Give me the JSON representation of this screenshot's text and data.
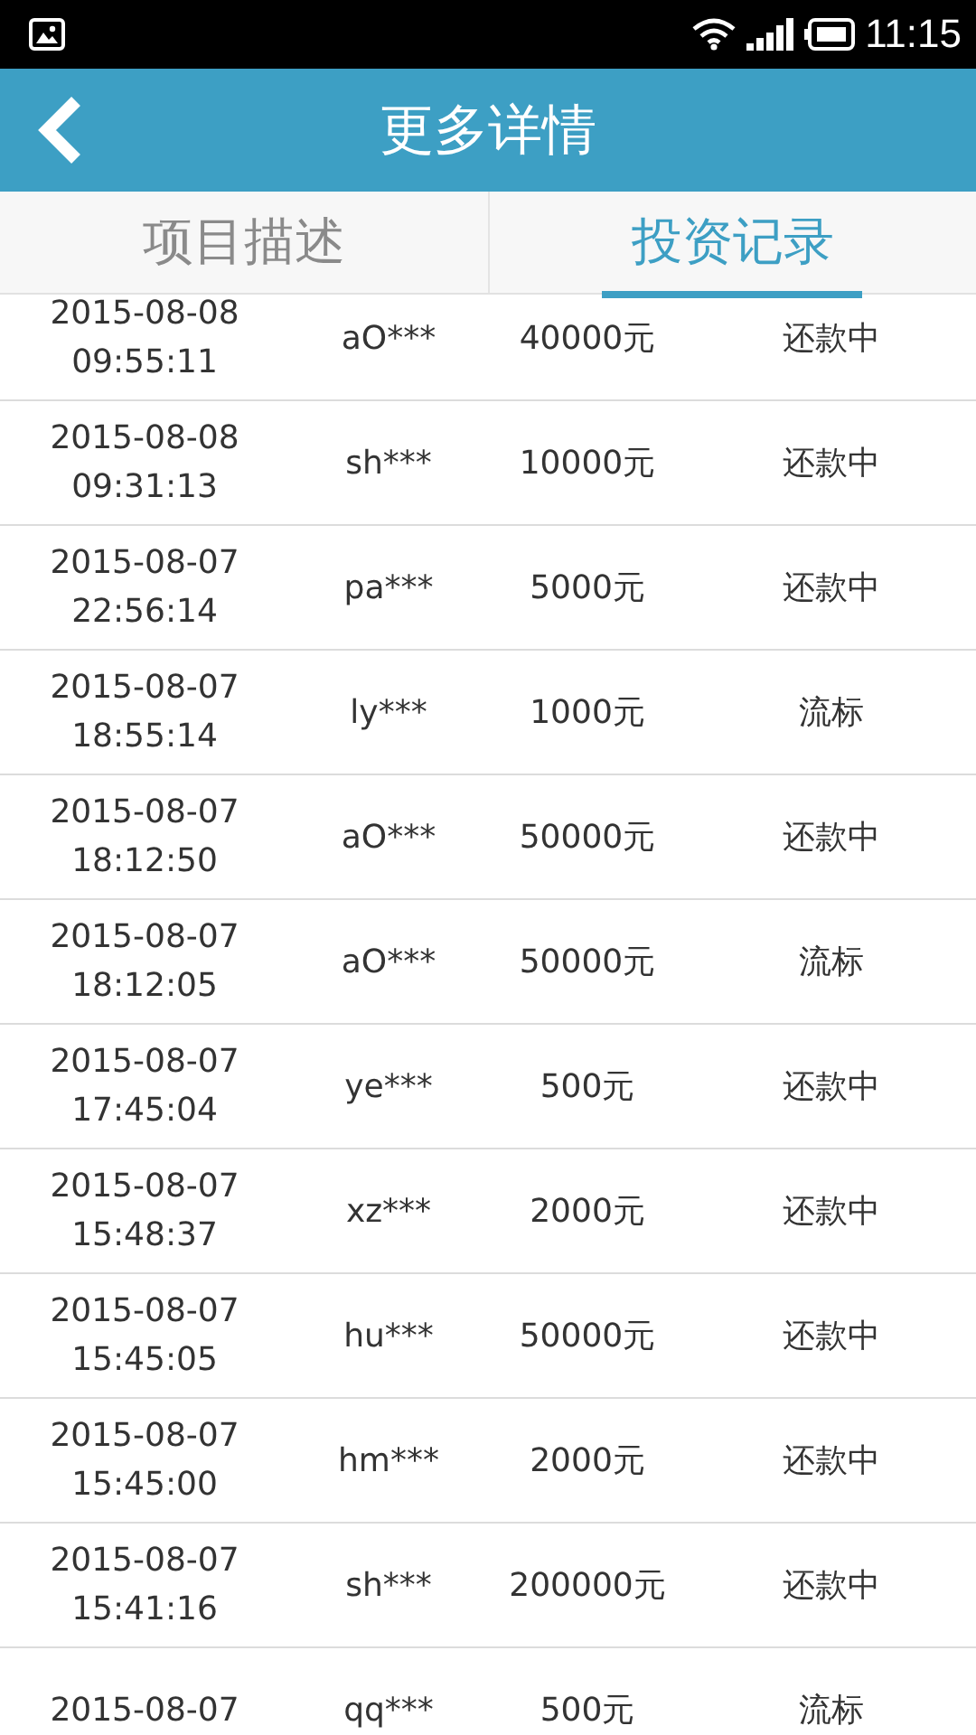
{
  "status_bar": {
    "time": "11:15"
  },
  "header": {
    "title": "更多详情"
  },
  "tabs": [
    {
      "label": "项目描述",
      "selected": false
    },
    {
      "label": "投资记录",
      "selected": true
    }
  ],
  "records": [
    {
      "date": "2015-08-08",
      "time": "09:55:11",
      "user": "aO***",
      "amount": "40000元",
      "status": "还款中"
    },
    {
      "date": "2015-08-08",
      "time": "09:31:13",
      "user": "sh***",
      "amount": "10000元",
      "status": "还款中"
    },
    {
      "date": "2015-08-07",
      "time": "22:56:14",
      "user": "pa***",
      "amount": "5000元",
      "status": "还款中"
    },
    {
      "date": "2015-08-07",
      "time": "18:55:14",
      "user": "ly***",
      "amount": "1000元",
      "status": "流标"
    },
    {
      "date": "2015-08-07",
      "time": "18:12:50",
      "user": "aO***",
      "amount": "50000元",
      "status": "还款中"
    },
    {
      "date": "2015-08-07",
      "time": "18:12:05",
      "user": "aO***",
      "amount": "50000元",
      "status": "流标"
    },
    {
      "date": "2015-08-07",
      "time": "17:45:04",
      "user": "ye***",
      "amount": "500元",
      "status": "还款中"
    },
    {
      "date": "2015-08-07",
      "time": "15:48:37",
      "user": "xz***",
      "amount": "2000元",
      "status": "还款中"
    },
    {
      "date": "2015-08-07",
      "time": "15:45:05",
      "user": "hu***",
      "amount": "50000元",
      "status": "还款中"
    },
    {
      "date": "2015-08-07",
      "time": "15:45:00",
      "user": "hm***",
      "amount": "2000元",
      "status": "还款中"
    },
    {
      "date": "2015-08-07",
      "time": "15:41:16",
      "user": "sh***",
      "amount": "200000元",
      "status": "还款中"
    },
    {
      "date": "2015-08-07",
      "user": "qq***",
      "amount": "500元",
      "status": "流标"
    }
  ]
}
